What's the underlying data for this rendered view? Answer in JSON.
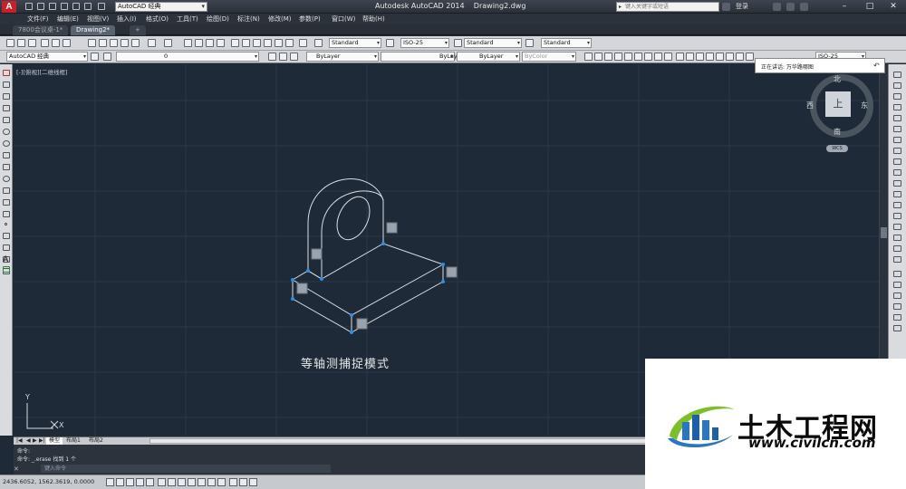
{
  "titlebar": {
    "app_title": "Autodesk AutoCAD 2014",
    "file_name": "Drawing2.dwg",
    "workspace": "AutoCAD 经典",
    "search_placeholder": "键入关键字或短语",
    "login": "登录"
  },
  "menu": [
    "文件(F)",
    "编辑(E)",
    "视图(V)",
    "插入(I)",
    "格式(O)",
    "工具(T)",
    "绘图(D)",
    "标注(N)",
    "修改(M)",
    "参数(P)",
    "窗口(W)",
    "帮助(H)"
  ],
  "tabs": [
    {
      "label": "7800会议桌-1*",
      "active": false
    },
    {
      "label": "Drawing2*",
      "active": true
    }
  ],
  "toolbar": {
    "text_style": "Standard",
    "dim_style": "ISO-25",
    "table_style": "Standard",
    "multileader_style": "Standard",
    "workspace2": "AutoCAD 经典",
    "layer": "0",
    "color": "ByLayer",
    "linetype": "ByLayer",
    "lineweight": "ByLayer",
    "plotstyle": "ByColor",
    "dim_style_right": "ISO-25"
  },
  "canvas": {
    "viewport_label": "[-][俯视][二维线框]",
    "caption": "等轴测捕捉模式",
    "ucs_y": "Y",
    "ucs_x": "X"
  },
  "viewcube": {
    "north": "北",
    "south": "南",
    "east": "东",
    "west": "西",
    "face": "上",
    "wcs": "WCS"
  },
  "speaker": {
    "text": "正在讲话: 万华路哪图"
  },
  "layout_tabs": [
    "模型",
    "布局1",
    "布局2"
  ],
  "command": {
    "line1": "命令:",
    "line2": "命令: _.erase 找到 1 个",
    "input_placeholder": "键入命令"
  },
  "status": {
    "coords": "2436.6052, 1562.3619, 0.0000"
  },
  "watermark": {
    "title": "土木工程网",
    "url": "www.civilcn.com"
  }
}
